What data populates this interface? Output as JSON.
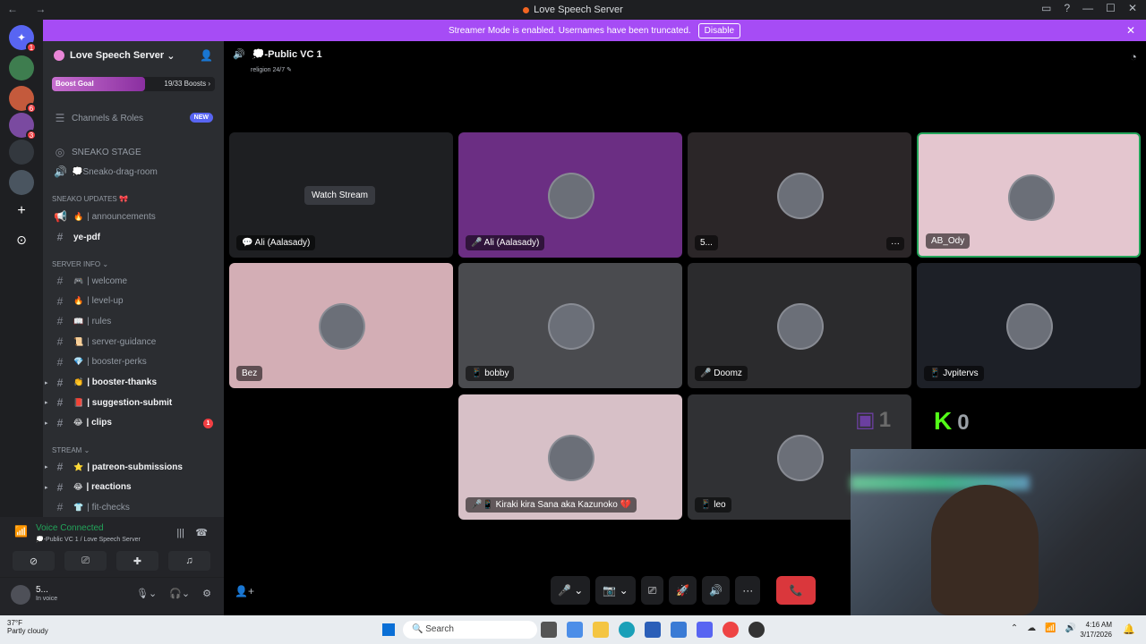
{
  "window": {
    "title": "Love Speech Server",
    "nav": "← →"
  },
  "banner": {
    "text": "Streamer Mode is enabled. Usernames have been truncated.",
    "button": "Disable"
  },
  "server_rail": {
    "badges": [
      "1",
      "6",
      "3"
    ]
  },
  "sidebar": {
    "server_name": "Love Speech Server",
    "boost": {
      "label": "Boost Goal",
      "count": "19/33 Boosts ›",
      "progress": 0.57
    },
    "channels_roles": {
      "label": "Channels & Roles",
      "badge": "NEW"
    },
    "stage": [
      {
        "label": "SNEAKO STAGE"
      },
      {
        "label": "💭Sneako-drag-room"
      }
    ],
    "cat_updates": "SNEAKO UPDATES 🎀",
    "updates": [
      {
        "emoji": "🔥",
        "label": "| announcements"
      },
      {
        "emoji": "",
        "label": "ye-pdf"
      }
    ],
    "cat_server_info": "SERVER INFO",
    "server_info": [
      {
        "emoji": "🎮",
        "label": "| welcome",
        "bold": false
      },
      {
        "emoji": "🔥",
        "label": "| level-up",
        "bold": false
      },
      {
        "emoji": "📖",
        "label": "| rules",
        "bold": false
      },
      {
        "emoji": "📜",
        "label": "| server-guidance",
        "bold": false
      },
      {
        "emoji": "💎",
        "label": "| booster-perks",
        "bold": false
      },
      {
        "emoji": "👏",
        "label": "| booster-thanks",
        "bold": true
      },
      {
        "emoji": "📕",
        "label": "| suggestion-submit",
        "bold": true
      },
      {
        "emoji": "😂",
        "label": "| clips",
        "bold": true,
        "badge": "1"
      }
    ],
    "cat_stream": "STREAM",
    "stream": [
      {
        "emoji": "⭐",
        "label": "| patreon-submissions",
        "bold": true
      },
      {
        "emoji": "😂",
        "label": "| reactions",
        "bold": true
      },
      {
        "emoji": "👕",
        "label": "| fit-checks",
        "bold": false
      }
    ]
  },
  "voice": {
    "status": "Voice Connected",
    "channel": "💭-Public VC 1 / Love Speech Server"
  },
  "user": {
    "name": "5...",
    "status": "In voice"
  },
  "channel": {
    "name": "💭-Public VC 1",
    "topic": "religion 24/7"
  },
  "tiles": [
    {
      "name": "💬 Ali (Aalasady)",
      "bg": "#1e1f22",
      "watch": "Watch Stream"
    },
    {
      "name": "🎤 Ali (Aalasady)",
      "bg": "#6b2e83"
    },
    {
      "name": "5...",
      "bg": "#2b2628",
      "more": "···"
    },
    {
      "name": "AB_Ody",
      "bg": "#e4c6cf",
      "speaking": true
    },
    {
      "name": "Bez",
      "bg": "#d3aeb5"
    },
    {
      "name": "📱 bobby",
      "bg": "#4a4b4f"
    },
    {
      "name": "🎤 Doomz",
      "bg": "#2b2b2d"
    },
    {
      "name": "📱 Jvpitervs",
      "bg": "#1d2027"
    },
    {
      "name": "🎤📱 Kiraki kira Sana aka Kazunoko 💔",
      "bg": "#d7c0c7"
    },
    {
      "name": "📱 leo",
      "bg": "#303134"
    }
  ],
  "overlay": {
    "twitch_count": "1",
    "kick_label": "K",
    "kick_count": "0"
  },
  "callbar": {
    "mic": "🎤 ⌄",
    "cam": "📷 ⌄",
    "share": "⎚",
    "activity": "🚀",
    "soundboard": "🔊",
    "more": "···",
    "end": "📞"
  },
  "taskbar": {
    "temp": "37°F",
    "weather": "Partly cloudy",
    "search": "Search",
    "time": "4:16 AM",
    "date": "3/17/2026"
  }
}
